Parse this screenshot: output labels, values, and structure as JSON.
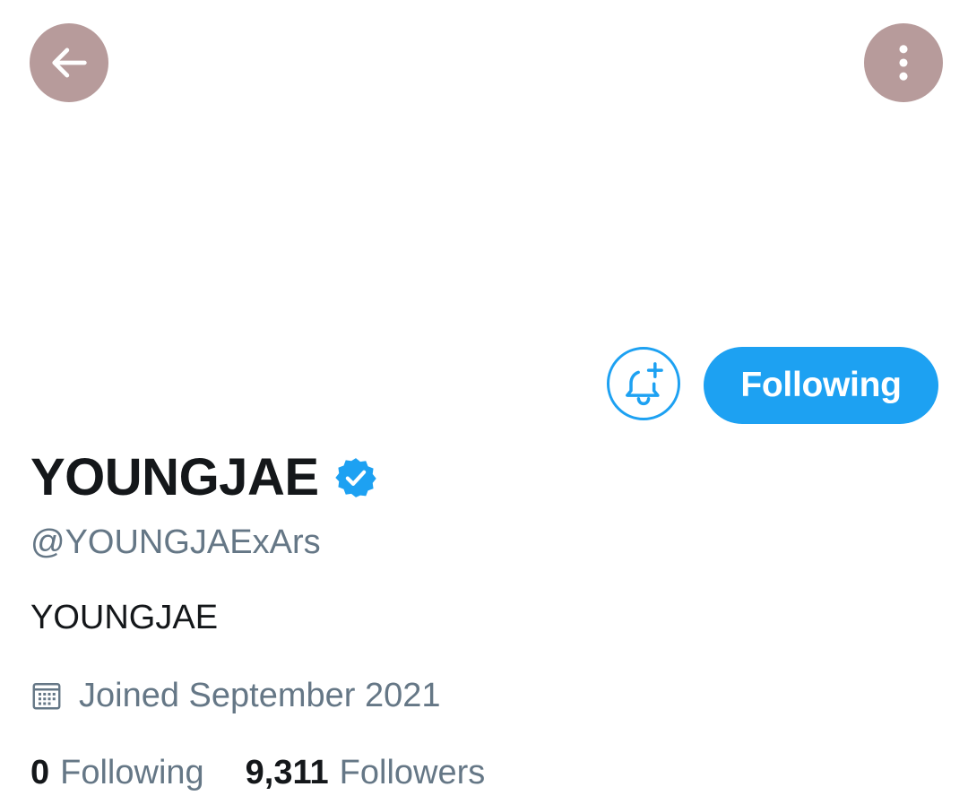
{
  "header": {
    "back_icon": "arrow-left-icon",
    "more_icon": "more-vertical-icon",
    "button_color": "#b79b9b"
  },
  "actions": {
    "notify_icon": "bell-plus-icon",
    "follow_label": "Following",
    "accent_color": "#1da1f2"
  },
  "profile": {
    "display_name": "YOUNGJAE",
    "verified_icon": "verified-badge-icon",
    "handle": "@YOUNGJAExArs",
    "bio": "YOUNGJAE",
    "joined_icon": "calendar-icon",
    "joined": "Joined September 2021"
  },
  "stats": {
    "following_count": "0",
    "following_label": "Following",
    "followers_count": "9,311",
    "followers_label": "Followers"
  }
}
